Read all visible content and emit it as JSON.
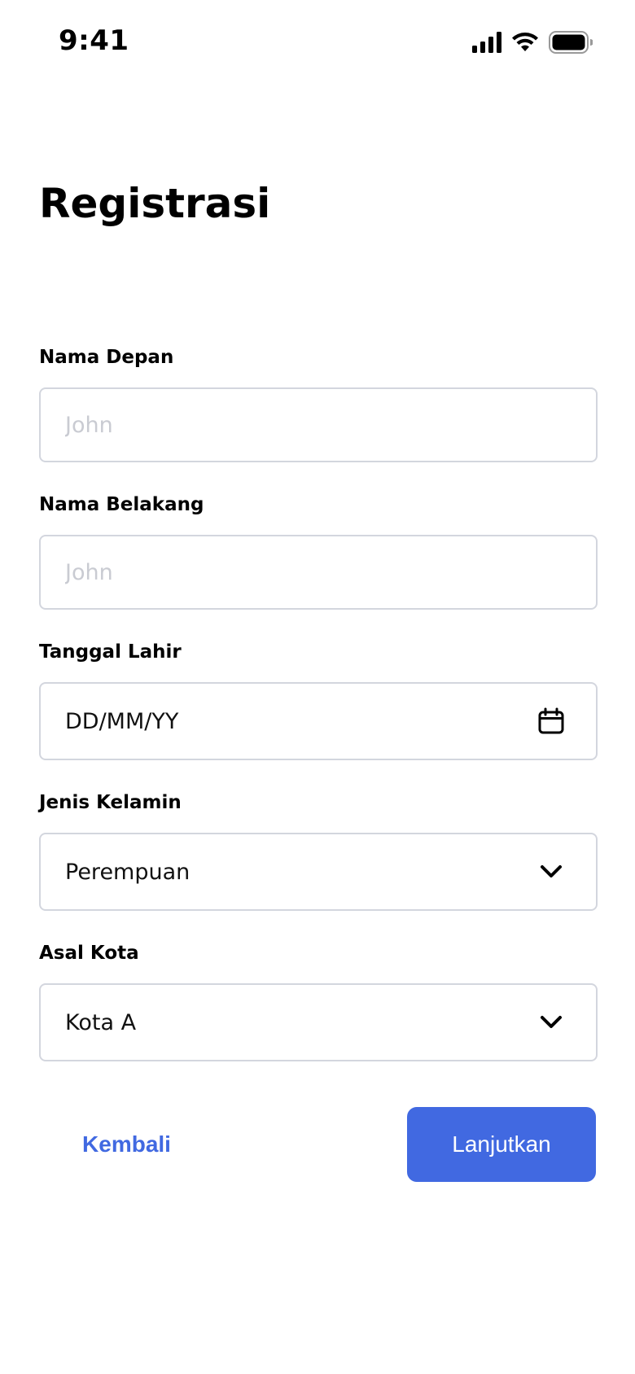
{
  "status_bar": {
    "time": "9:41",
    "icons": [
      "cellular-signal-icon",
      "wifi-icon",
      "battery-icon"
    ]
  },
  "title": "Registrasi",
  "form": {
    "first_name": {
      "label": "Nama Depan",
      "placeholder": "John",
      "value": ""
    },
    "last_name": {
      "label": "Nama Belakang",
      "placeholder": "John",
      "value": ""
    },
    "birth_date": {
      "label": "Tanggal Lahir",
      "value": "DD/MM/YY",
      "icon": "calendar-icon"
    },
    "gender": {
      "label": "Jenis Kelamin",
      "selected": "Perempuan",
      "icon": "chevron-down-icon"
    },
    "city": {
      "label": "Asal Kota",
      "selected": "Kota A",
      "icon": "chevron-down-icon"
    }
  },
  "actions": {
    "back_label": "Kembali",
    "next_label": "Lanjutkan"
  },
  "colors": {
    "accent": "#4169e1",
    "input_border": "#d3d6de",
    "placeholder": "#c9cbd2"
  }
}
